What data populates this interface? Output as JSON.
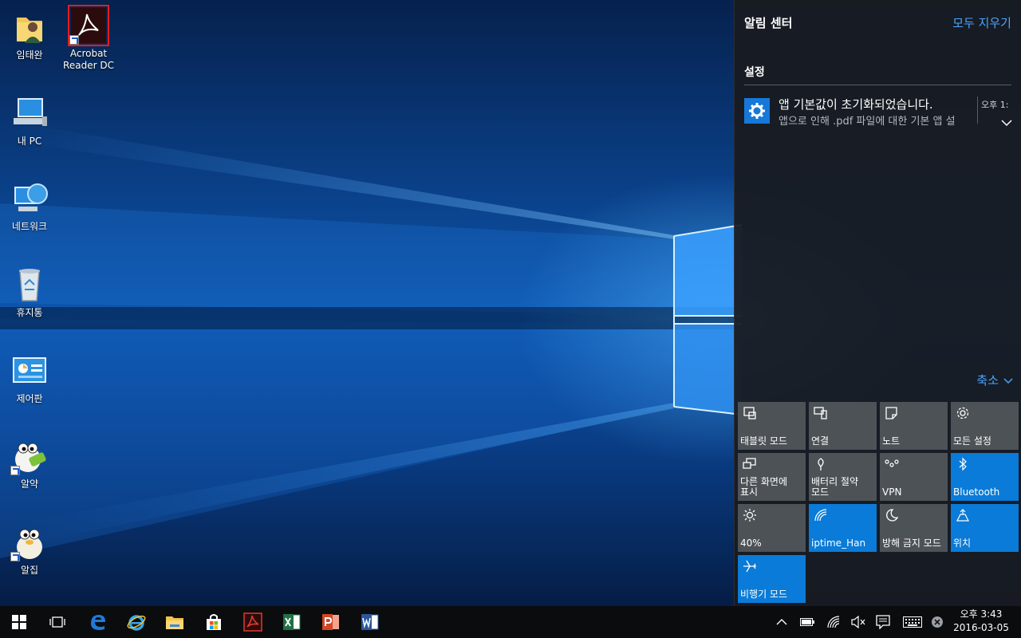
{
  "desktop": {
    "icons": [
      {
        "label": "임태완",
        "icon": "user-folder-icon"
      },
      {
        "label": "Acrobat Reader DC",
        "icon": "acrobat-icon"
      },
      {
        "label": "내 PC",
        "icon": "computer-icon"
      },
      {
        "label": "네트워크",
        "icon": "network-icon"
      },
      {
        "label": "휴지통",
        "icon": "recycle-bin-icon"
      },
      {
        "label": "제어판",
        "icon": "control-panel-icon"
      },
      {
        "label": "알약",
        "icon": "alyac-icon"
      },
      {
        "label": "알집",
        "icon": "alzip-icon"
      }
    ]
  },
  "action_center": {
    "title": "알림 센터",
    "clear_all": "모두 지우기",
    "group": "설정",
    "notification": {
      "title": "앱 기본값이 초기화되었습니다.",
      "body": "앱으로 인해 .pdf 파일에 대한 기본 앱 설",
      "time": "오후 1:",
      "icon": "gear-icon"
    },
    "collapse": "축소",
    "tiles": [
      {
        "label": "태블릿 모드",
        "icon": "tablet-mode-icon",
        "on": false
      },
      {
        "label": "연결",
        "icon": "connect-icon",
        "on": false
      },
      {
        "label": "노트",
        "icon": "note-icon",
        "on": false
      },
      {
        "label": "모든 설정",
        "icon": "gear-icon",
        "on": false
      },
      {
        "label": "다른 화면에 표시",
        "icon": "project-icon",
        "on": false
      },
      {
        "label": "배터리 절약 모드",
        "icon": "battery-saver-icon",
        "on": false
      },
      {
        "label": "VPN",
        "icon": "vpn-icon",
        "on": false
      },
      {
        "label": "Bluetooth",
        "icon": "bluetooth-icon",
        "on": true
      },
      {
        "label": "40%",
        "icon": "brightness-icon",
        "on": false
      },
      {
        "label": "iptime_Han",
        "icon": "wifi-icon",
        "on": true
      },
      {
        "label": "방해 금지 모드",
        "icon": "quiet-hours-icon",
        "on": false
      },
      {
        "label": "위치",
        "icon": "location-icon",
        "on": true
      },
      {
        "label": "비행기 모드",
        "icon": "airplane-icon",
        "on": true
      }
    ]
  },
  "taskbar": {
    "apps": [
      "start-icon",
      "task-view-icon",
      "edge-icon",
      "internet-explorer-icon",
      "file-explorer-icon",
      "store-icon",
      "acrobat-icon",
      "excel-icon",
      "powerpoint-icon",
      "word-icon"
    ],
    "clock": {
      "time": "오후 3:43",
      "date": "2016-03-05"
    }
  },
  "colors": {
    "accent": "#0a7bd8",
    "link": "#4aa6ff",
    "tile_off": "#4d5257"
  }
}
